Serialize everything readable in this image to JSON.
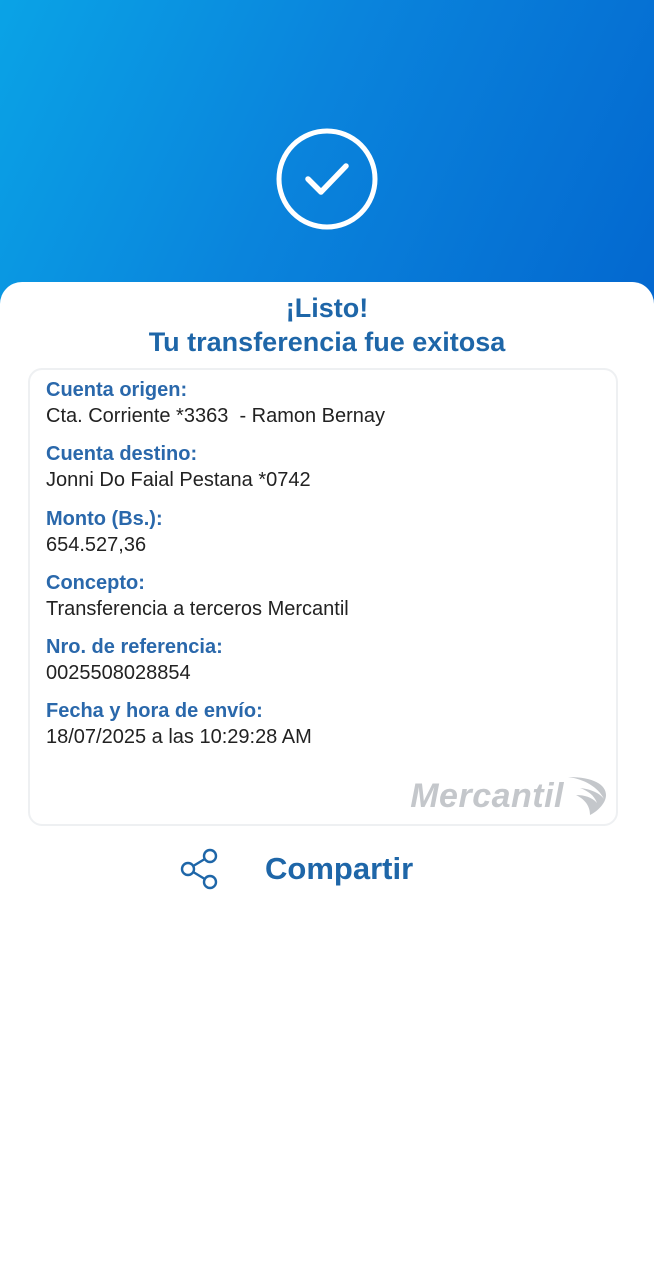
{
  "header": {
    "icon": "check-circle-icon",
    "gradient_start": "#0aa3e6",
    "gradient_end": "#0367cf"
  },
  "title": {
    "line1": "¡Listo!",
    "line2": "Tu transferencia fue exitosa"
  },
  "details": {
    "fields": [
      {
        "label": "Cuenta origen:",
        "value": "Cta. Corriente *3363  - Ramon Bernay"
      },
      {
        "label": "Cuenta destino:",
        "value": "Jonni Do Faial Pestana *0742"
      },
      {
        "label": "Monto (Bs.):",
        "value": "654.527,36"
      },
      {
        "label": "Concepto:",
        "value": "Transferencia a terceros Mercantil"
      },
      {
        "label": "Nro. de referencia:",
        "value": "0025508028854"
      },
      {
        "label": "Fecha y hora de envío:",
        "value": "18/07/2025 a las 10:29:28 AM"
      }
    ],
    "logo": "Mercantil"
  },
  "actions": {
    "share_icon": "share-icon",
    "share_label": "Compartir"
  },
  "colors": {
    "accent": "#1e66a8",
    "label": "#2a68ab",
    "text": "#222222"
  }
}
